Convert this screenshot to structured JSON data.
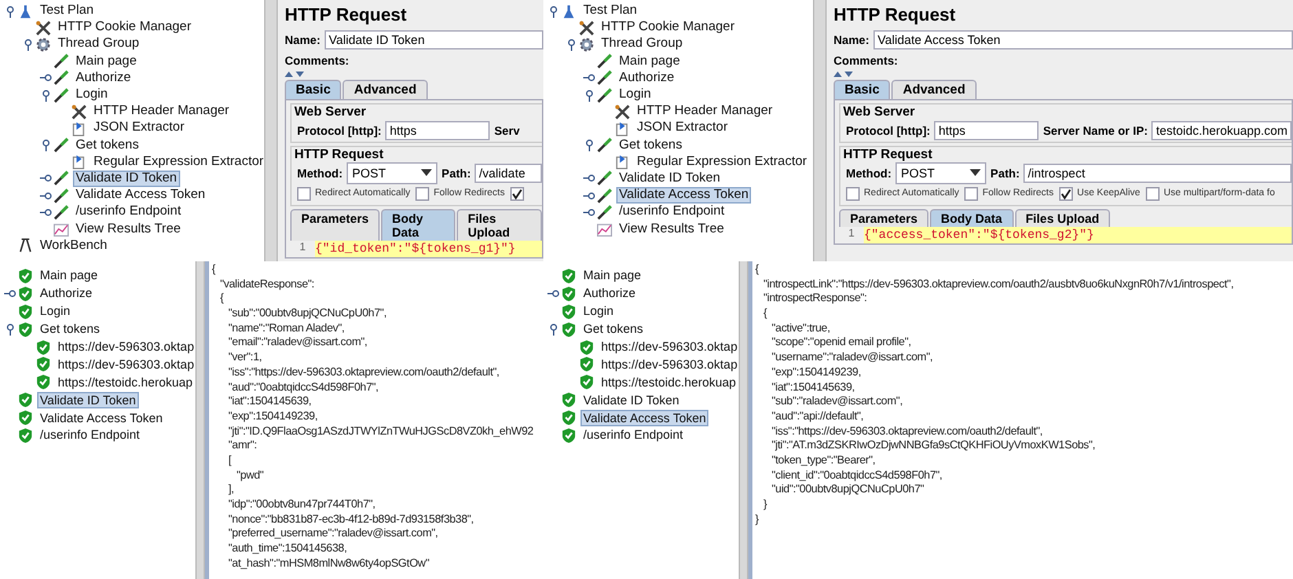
{
  "panels": [
    {
      "kind": "editor",
      "tree": [
        {
          "label": "Test Plan",
          "kind": "flask",
          "expanded": true,
          "selected": false,
          "children": [
            {
              "label": "HTTP Cookie Manager",
              "kind": "tools",
              "selected": false
            },
            {
              "label": "Thread Group",
              "kind": "gear",
              "expanded": true,
              "selected": false,
              "children": [
                {
                  "label": "Main page",
                  "kind": "pipette",
                  "selected": false
                },
                {
                  "label": "Authorize",
                  "kind": "pipette",
                  "expanded": false,
                  "selected": false
                },
                {
                  "label": "Login",
                  "kind": "pipette",
                  "expanded": true,
                  "selected": false,
                  "children": [
                    {
                      "label": "HTTP Header Manager",
                      "kind": "tools",
                      "selected": false
                    },
                    {
                      "label": "JSON Extractor",
                      "kind": "doc",
                      "selected": false
                    }
                  ]
                },
                {
                  "label": "Get tokens",
                  "kind": "pipette",
                  "expanded": true,
                  "selected": false,
                  "children": [
                    {
                      "label": "Regular Expression Extractor",
                      "kind": "doc",
                      "selected": false
                    }
                  ]
                },
                {
                  "label": "Validate ID Token",
                  "kind": "pipette",
                  "expanded": false,
                  "selected": true
                },
                {
                  "label": "Validate Access Token",
                  "kind": "pipette",
                  "expanded": false,
                  "selected": false
                },
                {
                  "label": "/userinfo Endpoint",
                  "kind": "pipette",
                  "expanded": false,
                  "selected": false
                },
                {
                  "label": "View Results Tree",
                  "kind": "chart",
                  "selected": false
                }
              ]
            }
          ]
        },
        {
          "label": "WorkBench",
          "kind": "easel",
          "selected": false
        }
      ],
      "request": {
        "title": "HTTP Request",
        "name_label": "Name:",
        "name": "Validate ID Token",
        "comments_label": "Comments:",
        "tabs": [
          {
            "label": "Basic",
            "selected": true
          },
          {
            "label": "Advanced",
            "selected": false
          }
        ],
        "web_server_label": "Web Server",
        "protocol_label": "Protocol [http]:",
        "protocol": "https",
        "server_label": "Serv",
        "http_request_label": "HTTP Request",
        "method_label": "Method:",
        "method": "POST",
        "path_label": "Path:",
        "path": "/validate",
        "options": [
          {
            "label": "Redirect Automatically",
            "checked": false
          },
          {
            "label": "Follow Redirects",
            "checked": false
          },
          {
            "checked": true
          }
        ],
        "body_tabs": [
          {
            "label": "Parameters",
            "selected": false
          },
          {
            "label": "Body Data",
            "selected": true
          },
          {
            "label": "Files Upload",
            "selected": false
          }
        ],
        "line_number": "1",
        "body": "{\"id_token\":\"${tokens_g1}\"}"
      }
    },
    {
      "kind": "editor",
      "tree": [
        {
          "label": "Test Plan",
          "kind": "flask",
          "expanded": true,
          "selected": false,
          "children": [
            {
              "label": "HTTP Cookie Manager",
              "kind": "tools",
              "selected": false
            },
            {
              "label": "Thread Group",
              "kind": "gear",
              "expanded": true,
              "selected": false,
              "children": [
                {
                  "label": "Main page",
                  "kind": "pipette",
                  "selected": false
                },
                {
                  "label": "Authorize",
                  "kind": "pipette",
                  "expanded": false,
                  "selected": false
                },
                {
                  "label": "Login",
                  "kind": "pipette",
                  "expanded": true,
                  "selected": false,
                  "children": [
                    {
                      "label": "HTTP Header Manager",
                      "kind": "tools",
                      "selected": false
                    },
                    {
                      "label": "JSON Extractor",
                      "kind": "doc",
                      "selected": false
                    }
                  ]
                },
                {
                  "label": "Get tokens",
                  "kind": "pipette",
                  "expanded": true,
                  "selected": false,
                  "children": [
                    {
                      "label": "Regular Expression Extractor",
                      "kind": "doc",
                      "selected": false
                    }
                  ]
                },
                {
                  "label": "Validate ID Token",
                  "kind": "pipette",
                  "expanded": false,
                  "selected": false
                },
                {
                  "label": "Validate Access Token",
                  "kind": "pipette",
                  "expanded": false,
                  "selected": true
                },
                {
                  "label": "/userinfo Endpoint",
                  "kind": "pipette",
                  "expanded": false,
                  "selected": false
                },
                {
                  "label": "View Results Tree",
                  "kind": "chart",
                  "selected": false
                }
              ]
            }
          ]
        }
      ],
      "request": {
        "title": "HTTP Request",
        "name_label": "Name:",
        "name": "Validate Access Token",
        "comments_label": "Comments:",
        "tabs": [
          {
            "label": "Basic",
            "selected": true
          },
          {
            "label": "Advanced",
            "selected": false
          }
        ],
        "web_server_label": "Web Server",
        "protocol_label": "Protocol [http]:",
        "protocol": "https",
        "server_label": "Server Name or IP:",
        "server": "testoidc.herokuapp.com",
        "http_request_label": "HTTP Request",
        "method_label": "Method:",
        "method": "POST",
        "path_label": "Path:",
        "path": "/introspect",
        "options": [
          {
            "label": "Redirect Automatically",
            "checked": false
          },
          {
            "label": "Follow Redirects",
            "checked": false
          },
          {
            "label": "Use KeepAlive",
            "checked": true
          },
          {
            "label": "Use multipart/form-data fo",
            "checked": false
          }
        ],
        "body_tabs": [
          {
            "label": "Parameters",
            "selected": false
          },
          {
            "label": "Body Data",
            "selected": true
          },
          {
            "label": "Files Upload",
            "selected": false
          }
        ],
        "line_number": "1",
        "body": "{\"access_token\":\"${tokens_g2}\"}"
      }
    },
    {
      "kind": "results",
      "tree": [
        {
          "label": "Main page",
          "kind": "pass",
          "selected": false
        },
        {
          "label": "Authorize",
          "kind": "pass",
          "expanded": false,
          "selected": false
        },
        {
          "label": "Login",
          "kind": "pass",
          "selected": false
        },
        {
          "label": "Get tokens",
          "kind": "pass",
          "expanded": true,
          "selected": false,
          "children": [
            {
              "label": "https://dev-596303.oktap",
              "kind": "pass",
              "selected": false
            },
            {
              "label": "https://dev-596303.oktap",
              "kind": "pass",
              "selected": false
            },
            {
              "label": "https://testoidc.herokuap",
              "kind": "pass",
              "selected": false
            }
          ]
        },
        {
          "label": "Validate ID Token",
          "kind": "pass",
          "selected": true
        },
        {
          "label": "Validate Access Token",
          "kind": "pass",
          "selected": false
        },
        {
          "label": "/userinfo Endpoint",
          "kind": "pass",
          "selected": false
        }
      ],
      "response": [
        {
          "line": "{",
          "children": [
            {
              "line": "\"validateResponse\":"
            },
            {
              "line": "{",
              "children": [
                {
                  "line": "\"sub\":\"00ubtv8upjQCNuCpU0h7\","
                },
                {
                  "line": "\"name\":\"Roman Aladev\","
                },
                {
                  "line": "\"email\":\"raladev@issart.com\","
                },
                {
                  "line": "\"ver\":1,"
                },
                {
                  "line": "\"iss\":\"https://dev-596303.oktapreview.com/oauth2/default\","
                },
                {
                  "line": "\"aud\":\"0oabtqidccS4d598F0h7\","
                },
                {
                  "line": "\"iat\":1504145639,"
                },
                {
                  "line": "\"exp\":1504149239,"
                },
                {
                  "line": "\"jti\":\"ID.Q9FlaaOsg1ASzdJTWYlZnTWuHJGScD8VZ0kh_ehW92"
                },
                {
                  "line": "\"amr\":"
                },
                {
                  "line": "[",
                  "children": [
                    {
                      "line": "\"pwd\""
                    }
                  ]
                },
                {
                  "line": "],"
                },
                {
                  "line": "\"idp\":\"00obtv8un47pr744T0h7\","
                },
                {
                  "line": "\"nonce\":\"bb831b87-ec3b-4f12-b89d-7d93158f3b38\","
                },
                {
                  "line": "\"preferred_username\":\"raladev@issart.com\","
                },
                {
                  "line": "\"auth_time\":1504145638,"
                },
                {
                  "line": "\"at_hash\":\"mHSM8mlNw8w6ty4opSGtOw\""
                }
              ]
            }
          ]
        }
      ]
    },
    {
      "kind": "results",
      "tree": [
        {
          "label": "Main page",
          "kind": "pass",
          "selected": false
        },
        {
          "label": "Authorize",
          "kind": "pass",
          "expanded": false,
          "selected": false
        },
        {
          "label": "Login",
          "kind": "pass",
          "selected": false
        },
        {
          "label": "Get tokens",
          "kind": "pass",
          "expanded": true,
          "selected": false,
          "children": [
            {
              "label": "https://dev-596303.oktap",
              "kind": "pass",
              "selected": false
            },
            {
              "label": "https://dev-596303.oktap",
              "kind": "pass",
              "selected": false
            },
            {
              "label": "https://testoidc.herokuap",
              "kind": "pass",
              "selected": false
            }
          ]
        },
        {
          "label": "Validate ID Token",
          "kind": "pass",
          "selected": false
        },
        {
          "label": "Validate Access Token",
          "kind": "pass",
          "selected": true
        },
        {
          "label": "/userinfo Endpoint",
          "kind": "pass",
          "selected": false
        }
      ],
      "response": [
        {
          "line": "{",
          "children": [
            {
              "line": "\"introspectLink\":\"https://dev-596303.oktapreview.com/oauth2/ausbtv8uo6kuNxgnR0h7/v1/introspect\","
            },
            {
              "line": "\"introspectResponse\":"
            },
            {
              "line": "{",
              "children": [
                {
                  "line": "\"active\":true,"
                },
                {
                  "line": "\"scope\":\"openid email profile\","
                },
                {
                  "line": "\"username\":\"raladev@issart.com\","
                },
                {
                  "line": "\"exp\":1504149239,"
                },
                {
                  "line": "\"iat\":1504145639,"
                },
                {
                  "line": "\"sub\":\"raladev@issart.com\","
                },
                {
                  "line": "\"aud\":\"api://default\","
                },
                {
                  "line": "\"iss\":\"https://dev-596303.oktapreview.com/oauth2/default\","
                },
                {
                  "line": "\"jti\":\"AT.m3dZSKRIwOzDjwNNBGfa9sCtQKHFiOUyVmoxKW1Sobs\","
                },
                {
                  "line": "\"token_type\":\"Bearer\","
                },
                {
                  "line": "\"client_id\":\"0oabtqidccS4d598F0h7\","
                },
                {
                  "line": "\"uid\":\"00ubtv8upjQCNuCpU0h7\""
                }
              ]
            },
            {
              "line": "}"
            }
          ]
        },
        {
          "line": "}"
        }
      ]
    }
  ]
}
